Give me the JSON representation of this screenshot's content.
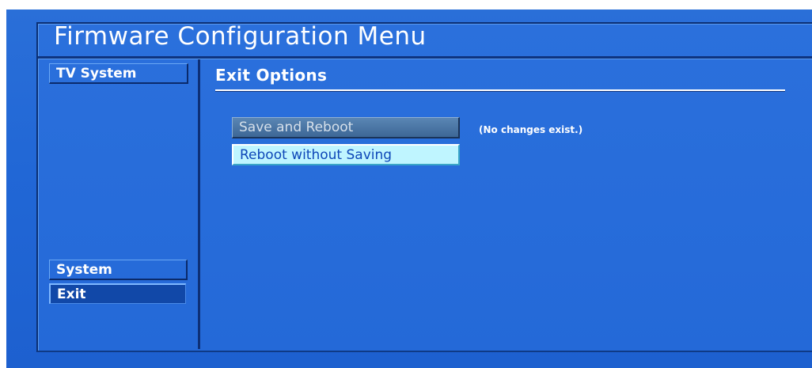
{
  "app": {
    "title": "Firmware Configuration Menu"
  },
  "sidebar": {
    "items": [
      {
        "label": "TV System"
      },
      {
        "label": "System"
      },
      {
        "label": "Exit"
      }
    ],
    "selected": "Exit"
  },
  "main": {
    "section_title": "Exit Options",
    "buttons": [
      {
        "label": "Save and Reboot",
        "state": "disabled"
      },
      {
        "label": "Reboot without Saving",
        "state": "focused"
      }
    ],
    "status": "(No changes exist.)"
  },
  "colors": {
    "background": "#2167d6",
    "focus_highlight": "#bff5ff",
    "disabled_button": "#4a76a4",
    "text": "#ffffff"
  }
}
